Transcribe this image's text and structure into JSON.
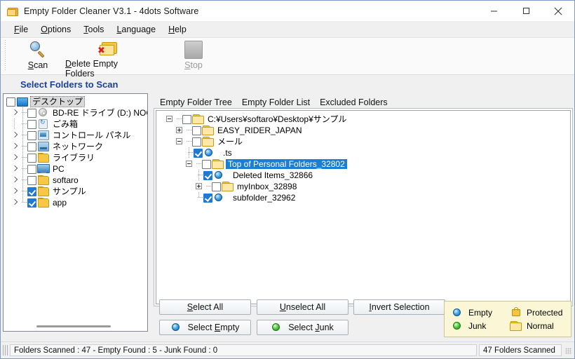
{
  "window": {
    "title": "Empty Folder Cleaner V3.1 - 4dots Software",
    "icon": "folder-icon",
    "controls": {
      "minimize": "minimize-icon",
      "maximize": "maximize-icon",
      "close": "close-icon"
    }
  },
  "menu": [
    {
      "label": "File",
      "accel": "F"
    },
    {
      "label": "Options",
      "accel": "O"
    },
    {
      "label": "Tools",
      "accel": "T"
    },
    {
      "label": "Language",
      "accel": "L"
    },
    {
      "label": "Help",
      "accel": "H"
    }
  ],
  "toolbar": {
    "scan": {
      "label": "Scan",
      "icon": "magnifier-icon",
      "enabled": true
    },
    "delete": {
      "label": "Delete Empty Folders",
      "icon": "folder-delete-icon",
      "enabled": true
    },
    "stop": {
      "label": "Stop",
      "icon": "stop-square-icon",
      "enabled": false
    }
  },
  "section": {
    "heading": "Select Folders to Scan"
  },
  "folder_tree": {
    "rows": [
      {
        "label": "デスクトップ",
        "icon": "desktop-icon",
        "indent": 0,
        "expander": "none",
        "checked": false,
        "focus": true
      },
      {
        "label": "BD-RE ドライブ (D:) NOCOUNTRY",
        "icon": "disc-icon",
        "indent": 1,
        "expander": "chevron",
        "checked": false
      },
      {
        "label": "ごみ箱",
        "icon": "recycle-bin-icon",
        "indent": 1,
        "expander": "none",
        "checked": false
      },
      {
        "label": "コントロール パネル",
        "icon": "control-panel-icon",
        "indent": 1,
        "expander": "chevron",
        "checked": false
      },
      {
        "label": "ネットワーク",
        "icon": "network-icon",
        "indent": 1,
        "expander": "chevron",
        "checked": false
      },
      {
        "label": "ライブラリ",
        "icon": "folder-icon",
        "indent": 1,
        "expander": "chevron",
        "checked": false
      },
      {
        "label": "PC",
        "icon": "pc-icon",
        "indent": 1,
        "expander": "chevron",
        "checked": false
      },
      {
        "label": "softaro",
        "icon": "folder-icon",
        "indent": 1,
        "expander": "chevron",
        "checked": false
      },
      {
        "label": "サンプル",
        "icon": "folder-icon",
        "indent": 1,
        "expander": "chevron",
        "checked": true
      },
      {
        "label": "app",
        "icon": "folder-icon",
        "indent": 1,
        "expander": "chevron",
        "checked": true
      }
    ]
  },
  "tabs": [
    {
      "label": "Empty Folder Tree",
      "active": true
    },
    {
      "label": "Empty Folder List",
      "active": false
    },
    {
      "label": "Excluded Folders",
      "active": false
    }
  ],
  "result_tree": {
    "rows": [
      {
        "label": "C:¥Users¥softaro¥Desktop¥サンプル",
        "icon": "folder-open-icon",
        "indent": 0,
        "expander": "minus",
        "checked": false,
        "selected": false
      },
      {
        "label": "EASY_RIDER_JAPAN",
        "icon": "folder-open-icon",
        "indent": 1,
        "expander": "plus",
        "checked": false,
        "selected": false
      },
      {
        "label": "メール",
        "icon": "folder-open-icon",
        "indent": 1,
        "expander": "minus",
        "checked": false,
        "selected": false
      },
      {
        "label": ".ts",
        "icon": "empty-ball-icon",
        "indent": 2,
        "expander": "none",
        "checked": true,
        "selected": false
      },
      {
        "label": "Top of Personal Folders_32802",
        "icon": "folder-open-icon",
        "indent": 2,
        "expander": "minus",
        "checked": false,
        "selected": true
      },
      {
        "label": "Deleted Items_32866",
        "icon": "empty-ball-icon",
        "indent": 3,
        "expander": "none",
        "checked": true,
        "selected": false
      },
      {
        "label": "myInbox_32898",
        "icon": "folder-open-icon",
        "indent": 3,
        "expander": "plus",
        "checked": false,
        "selected": false
      },
      {
        "label": "subfolder_32962",
        "icon": "empty-ball-icon",
        "indent": 3,
        "expander": "none",
        "checked": true,
        "selected": false
      }
    ]
  },
  "actions": {
    "select_all": {
      "label": "Select All",
      "accel": "S"
    },
    "unselect_all": {
      "label": "Unselect All",
      "accel": "U"
    },
    "invert_selection": {
      "label": "Invert Selection",
      "accel": "I"
    },
    "select_empty": {
      "label": "Select Empty",
      "accel": "E",
      "icon": "empty-ball-icon"
    },
    "select_junk": {
      "label": "Select Junk",
      "accel": "J",
      "icon": "junk-ball-icon"
    }
  },
  "legend": [
    {
      "label": "Empty",
      "icon": "empty-ball-icon"
    },
    {
      "label": "Protected",
      "icon": "lock-icon"
    },
    {
      "label": "Junk",
      "icon": "junk-ball-icon"
    },
    {
      "label": "Normal",
      "icon": "folder-open-icon"
    }
  ],
  "status": {
    "main": "Folders Scanned : 47 - Empty Found : 5 - Junk Found : 0",
    "right": "47 Folders Scanned"
  },
  "colors": {
    "heading": "#1b3fa0",
    "selection": "#1a7fd4",
    "legend_bg": "#fbf7d6",
    "checkbox_checked": "#1f78d1"
  }
}
